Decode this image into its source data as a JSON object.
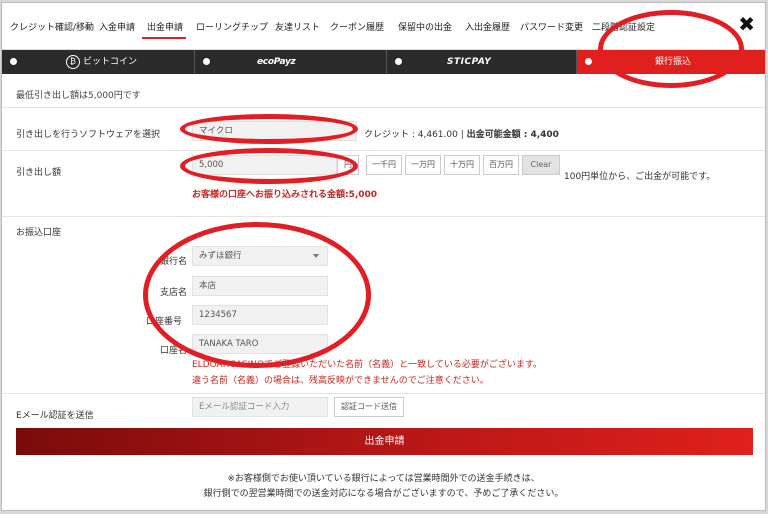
{
  "tabs": [
    {
      "label": "クレジット確認/移動"
    },
    {
      "label": "入金申請"
    },
    {
      "label": "出金申請"
    },
    {
      "label": "ローリングチップ"
    },
    {
      "label": "友達リスト"
    },
    {
      "label": "クーポン履歴"
    },
    {
      "label": "保留中の出金"
    },
    {
      "label": "入出金履歴"
    },
    {
      "label": "パスワード変更"
    },
    {
      "label": "二段階認証設定"
    }
  ],
  "close_icon": "✖",
  "methods": [
    {
      "label": "ビットコイン",
      "icon": "bitcoin-icon",
      "glyph": "₿"
    },
    {
      "label": "ecoPayz"
    },
    {
      "label": "STICPAY"
    },
    {
      "label": "銀行振込"
    }
  ],
  "min_note": "最低引き出し額は5,000円です",
  "software": {
    "label": "引き出しを行うソフトウェアを選択",
    "value": "マイクロ",
    "credit_text": "クレジット : 4,461.00 | ",
    "available_text": "出金可能金額 : 4,400"
  },
  "amount": {
    "label": "引き出し額",
    "value": "5,000",
    "unit": "円",
    "buttons": [
      "一千円",
      "一万円",
      "十万円",
      "百万円"
    ],
    "clear": "Clear",
    "note": "100円単位から、ご出金が可能です。",
    "transfer_text": "お客様の口座へお振り込みされる金額:5,000"
  },
  "bank": {
    "section_label": "お振込口座",
    "bank_label": "銀行名",
    "bank_value": "みずほ銀行",
    "branch_label": "支店名",
    "branch_value": "本店",
    "account_label": "口座番号",
    "account_value": "1234567",
    "holder_label": "口座名",
    "holder_value": "TANAKA TARO",
    "warning1": "ELDOAHCASINOでご登録いただいた名前（名義）と一致している必要がございます。",
    "warning2": "違う名前（名義）の場合は、残高反映ができませんのでご注意ください。"
  },
  "email": {
    "label": "Eメール認証を送信",
    "placeholder": "Eメール認証コード入力",
    "send_button": "認証コード送信"
  },
  "submit_label": "出金申請",
  "footer": {
    "line1": "※お客様側でお使い頂いている銀行によっては営業時間外での送金手続きは、",
    "line2": "銀行側での翌営業時間での送金対応になる場合がございますので、予めご了承ください。"
  },
  "colors": {
    "accent": "#e0201c",
    "dark_bar": "#2b2b2b",
    "annotation": "#e21d23"
  }
}
